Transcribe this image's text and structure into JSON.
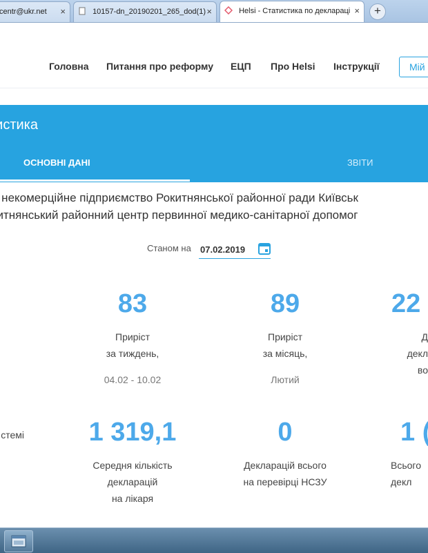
{
  "browser": {
    "tabs": [
      {
        "label": "centr@ukr.net",
        "active": false
      },
      {
        "label": "10157-dn_20190201_265_dod(1)",
        "active": false
      },
      {
        "label": "Helsi - Статистика по деклараці",
        "active": true
      }
    ],
    "close_glyph": "×",
    "new_tab_glyph": "+"
  },
  "nav": {
    "items": [
      "Головна",
      "Питання про реформу",
      "ЕЦП",
      "Про Helsi",
      "Інструкції"
    ],
    "cabinet_button": "Мій"
  },
  "page": {
    "title": "тистика",
    "tabs": [
      "ОСНОВНІ ДАНІ",
      "ЗВІТИ"
    ]
  },
  "organization": {
    "line1": "е некомерційне підприємство Рокитнянської районної ради Київськ",
    "line2": "китнянський районний центр первинної медико-санітарної допомог"
  },
  "as_of": {
    "label": "Станом на",
    "date": "07.02.2019"
  },
  "stats_row1": [
    {
      "value": "83",
      "label": "Приріст\nза тиждень,",
      "sub": "04.02 - 10.02"
    },
    {
      "value": "89",
      "label": "Приріст\nза місяць,",
      "sub": "Лютий"
    },
    {
      "value": "22",
      "label": "Д\nдекл\nво",
      "sub": ""
    }
  ],
  "stats_row2": [
    {
      "value": "",
      "label": "стемі",
      "sub": ""
    },
    {
      "value": "1 319,1",
      "label": "Середня кількість\nдекларацій\nна лікаря",
      "sub": ""
    },
    {
      "value": "0",
      "label": "Декларацій всього\nна перевірці НСЗУ",
      "sub": ""
    },
    {
      "value": "1 (",
      "label": "Всього\nдекл",
      "sub": ""
    }
  ],
  "colors": {
    "accent": "#27a3e0",
    "number": "#4da9ea"
  },
  "icons": {
    "calendar": "calendar-icon",
    "tab_favicon": "helsi-favicon-icon",
    "taskbar": "explorer-window-icon"
  }
}
